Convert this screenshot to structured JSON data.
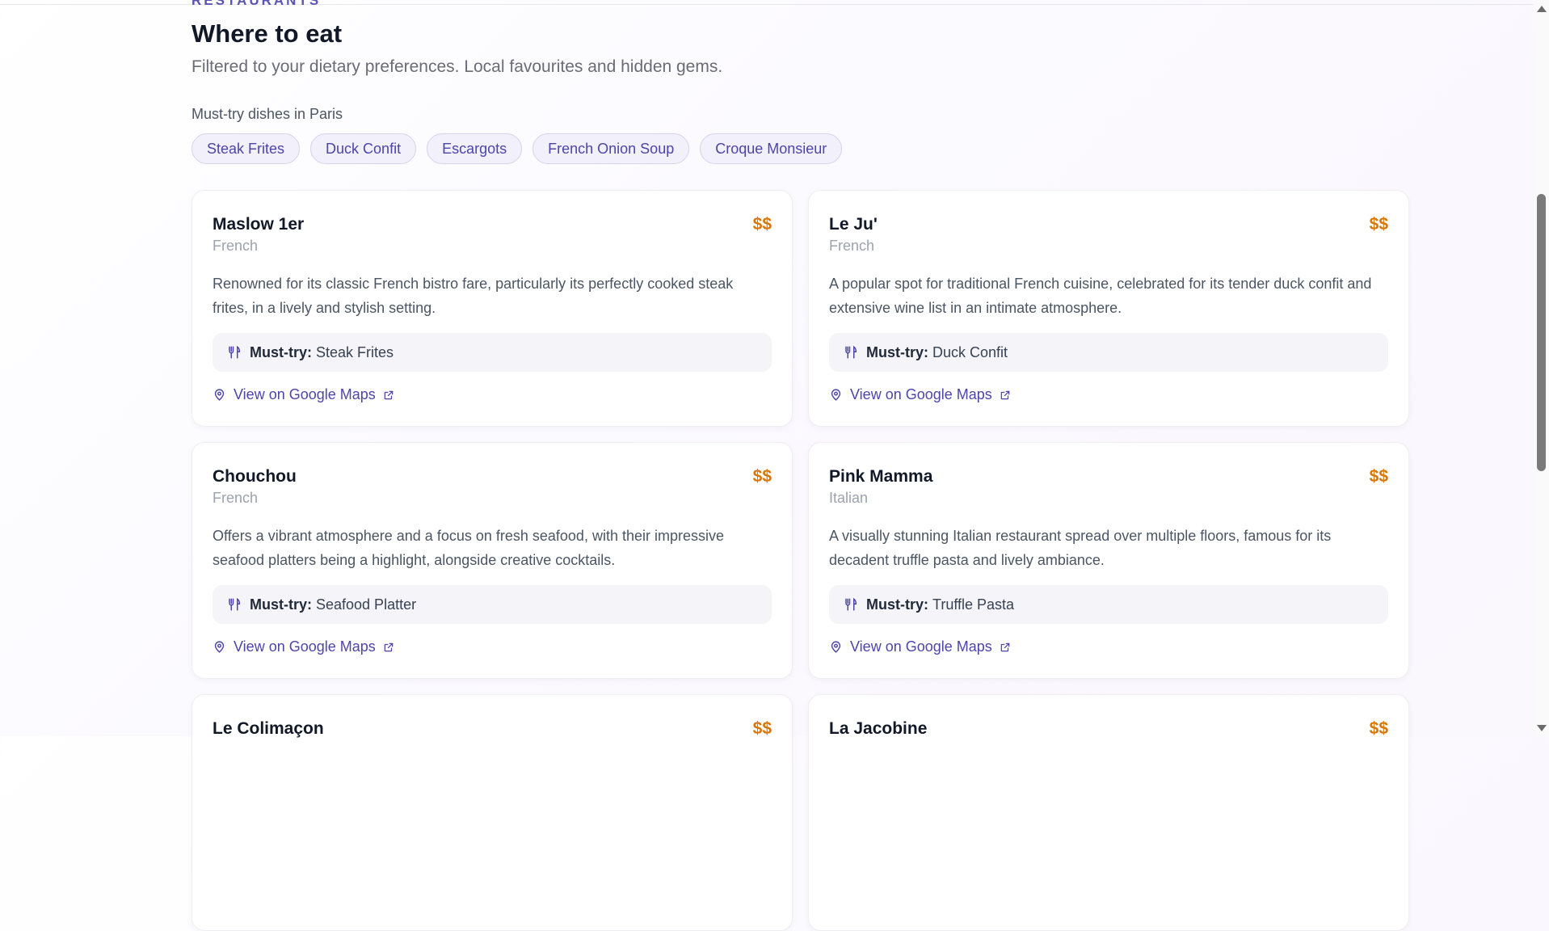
{
  "section": {
    "eyebrow": "Restaurants",
    "title": "Where to eat",
    "subtitle": "Filtered to your dietary preferences. Local favourites and hidden gems."
  },
  "dishes": {
    "heading": "Must-try dishes in Paris",
    "items": [
      "Steak Frites",
      "Duck Confit",
      "Escargots",
      "French Onion Soup",
      "Croque Monsieur"
    ]
  },
  "restaurants": [
    {
      "name": "Maslow 1er",
      "price": "$$",
      "cuisine": "French",
      "description": "Renowned for its classic French bistro fare, particularly its perfectly cooked steak frites, in a lively and stylish setting.",
      "must_try_label": "Must-try:",
      "must_try": "Steak Frites",
      "maps_label": "View on Google Maps"
    },
    {
      "name": "Le Ju'",
      "price": "$$",
      "cuisine": "French",
      "description": "A popular spot for traditional French cuisine, celebrated for its tender duck confit and extensive wine list in an intimate atmosphere.",
      "must_try_label": "Must-try:",
      "must_try": "Duck Confit",
      "maps_label": "View on Google Maps"
    },
    {
      "name": "Chouchou",
      "price": "$$",
      "cuisine": "French",
      "description": "Offers a vibrant atmosphere and a focus on fresh seafood, with their impressive seafood platters being a highlight, alongside creative cocktails.",
      "must_try_label": "Must-try:",
      "must_try": "Seafood Platter",
      "maps_label": "View on Google Maps"
    },
    {
      "name": "Pink Mamma",
      "price": "$$",
      "cuisine": "Italian",
      "description": "A visually stunning Italian restaurant spread over multiple floors, famous for its decadent truffle pasta and lively ambiance.",
      "must_try_label": "Must-try:",
      "must_try": "Truffle Pasta",
      "maps_label": "View on Google Maps"
    },
    {
      "name": "Le Colimaçon",
      "price": "$$"
    },
    {
      "name": "La Jacobine",
      "price": "$$"
    }
  ],
  "colors": {
    "accent": "#4d45a8",
    "price": "#d97706",
    "chip_bg": "#f1f0fb"
  },
  "icons": [
    "fork-knife-icon",
    "map-pin-icon",
    "external-link-icon"
  ]
}
